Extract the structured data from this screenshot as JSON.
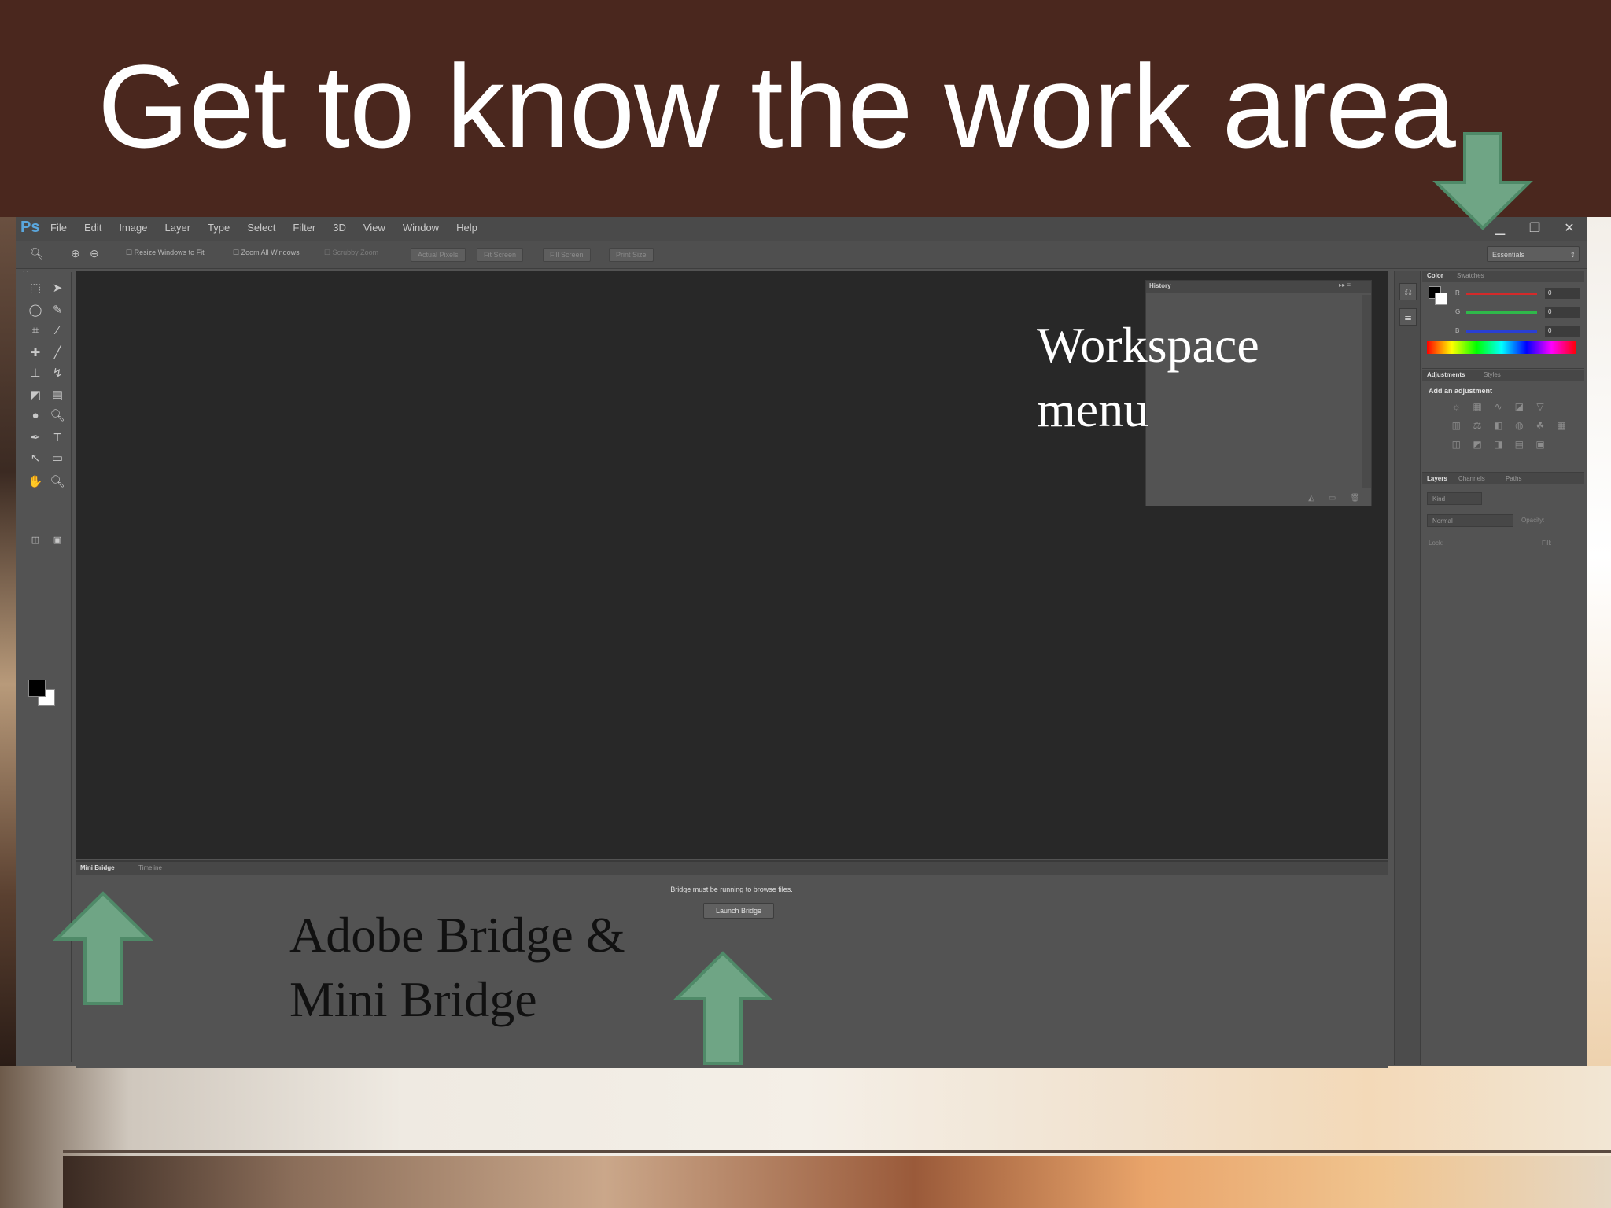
{
  "slide": {
    "title": "Get to know the work area",
    "colors": {
      "title_bar": "#4a271e",
      "arrow": "#6fa585",
      "arrow_edge": "#4f8a68"
    }
  },
  "app": {
    "logo": "Ps",
    "menu": [
      "File",
      "Edit",
      "Image",
      "Layer",
      "Type",
      "Select",
      "Filter",
      "3D",
      "View",
      "Window",
      "Help"
    ],
    "window_controls": {
      "minimize": "▁",
      "restore": "❐",
      "close": "✕"
    }
  },
  "options_bar": {
    "resize_windows": "Resize Windows to Fit",
    "zoom_all": "Zoom All Windows",
    "scrubby_zoom": "Scrubby Zoom",
    "actual_pixels": "Actual Pixels",
    "fit_screen": "Fit Screen",
    "fill_screen": "Fill Screen",
    "print_size": "Print Size",
    "workspace": "Essentials"
  },
  "panels": {
    "history": {
      "tab": "History"
    },
    "color": {
      "tab_active": "Color",
      "tab_other": "Swatches",
      "rows": [
        {
          "label": "R",
          "value": "0",
          "color": "#d42a2a"
        },
        {
          "label": "G",
          "value": "0",
          "color": "#2fb84a"
        },
        {
          "label": "B",
          "value": "0",
          "color": "#2a3fd4"
        }
      ]
    },
    "adjustments": {
      "tab_active": "Adjustments",
      "tab_other": "Styles",
      "title": "Add an adjustment"
    },
    "layers": {
      "tab_active": "Layers",
      "tab_channels": "Channels",
      "tab_paths": "Paths",
      "kind": "Kind",
      "blend_mode": "Normal",
      "opacity_label": "Opacity:",
      "lock_label": "Lock:",
      "fill_label": "Fill:"
    }
  },
  "mini_bridge": {
    "tab_active": "Mini Bridge",
    "tab_other": "Timeline",
    "message": "Bridge must be running to browse files.",
    "launch_button": "Launch Bridge"
  },
  "annotations": {
    "workspace_line1": "Workspace",
    "workspace_line2": "menu",
    "bridge_line1": "Adobe Bridge &",
    "bridge_line2": "Mini Bridge"
  }
}
